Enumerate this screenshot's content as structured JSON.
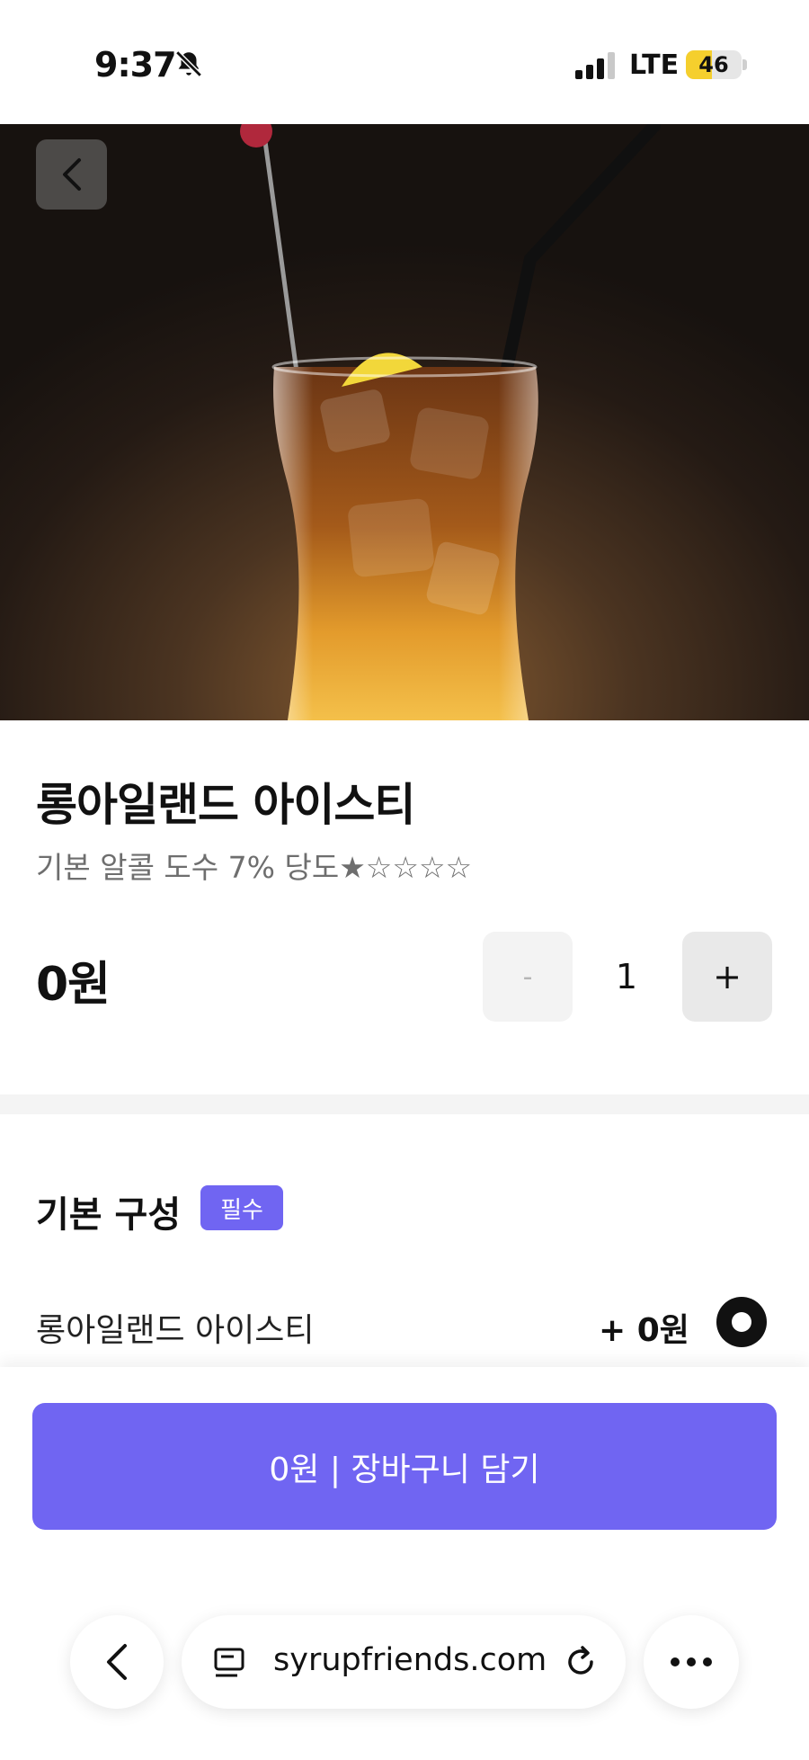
{
  "status_bar": {
    "time": "9:37",
    "network": "LTE",
    "battery": "46",
    "battery_level": 0.46,
    "icons": [
      "bell-slash-icon",
      "signal-icon",
      "battery-icon"
    ]
  },
  "hero": {
    "image": "long-island-iced-tea-photo",
    "back_icon": "chevron-left-icon"
  },
  "product": {
    "title": "롱아일랜드 아이스티",
    "description": "기본 알콜 도수 7%  당도★☆☆☆☆",
    "price": "0원"
  },
  "quantity": {
    "minus": "-",
    "value": "1",
    "plus": "+"
  },
  "base_options": {
    "title": "기본 구성",
    "badge": "필수",
    "items": [
      {
        "label": "롱아일랜드 아이스티",
        "price": "+ 0원",
        "selected": true
      }
    ]
  },
  "cart_button": {
    "label": "0원  |  장바구니 담기"
  },
  "browser": {
    "url": "syrupfriends.com",
    "back_icon": "chevron-left-icon",
    "page_icon": "page-icon",
    "reload_icon": "reload-icon",
    "more_icon": "more-icon"
  },
  "colors": {
    "accent": "#7065f2",
    "text": "#111111",
    "muted": "#6e6e6e"
  }
}
